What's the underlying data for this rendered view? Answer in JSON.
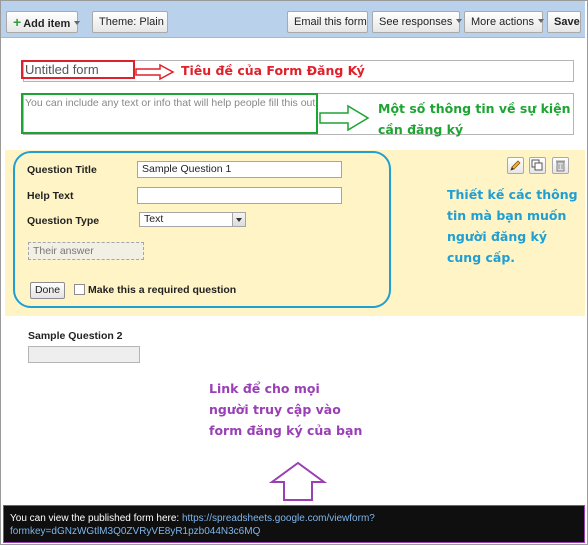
{
  "toolbar": {
    "add_item": "Add item",
    "theme_label": "Theme:",
    "theme_value": "Plain",
    "email_form": "Email this form",
    "see_responses": "See responses",
    "more_actions": "More actions",
    "save": "Save"
  },
  "form": {
    "title": "Untitled form",
    "description_placeholder": "You can include any text or info that will help people fill this out."
  },
  "question_editor": {
    "title_label": "Question Title",
    "title_value": "Sample Question 1",
    "help_label": "Help Text",
    "help_value": "",
    "type_label": "Question Type",
    "type_value": "Text",
    "answer_placeholder": "Their answer",
    "done": "Done",
    "required_label": "Make this a required question"
  },
  "question2": {
    "label": "Sample Question 2"
  },
  "annotations": {
    "title_note": "Tiêu đề của  Form Đăng Ký",
    "desc_note_line1": "Một số thông tin về sự kiện",
    "desc_note_line2": "cần đăng ký",
    "design_note_line1": "Thiết kế các thông",
    "design_note_line2": "tin mà bạn muốn",
    "design_note_line3": "người đăng ký",
    "design_note_line4": "cung cấp.",
    "link_note_line1": "Link để cho mọi",
    "link_note_line2": "người truy cập vào",
    "link_note_line3": "form đăng ký của bạn"
  },
  "footer": {
    "text": "You can view the published form here: ",
    "link_line1": "https://spreadsheets.google.com/viewform?",
    "link_line2": "formkey=dGNzWGtlM3Q0ZVRyVE8yR1pzb044N3c6MQ"
  },
  "colors": {
    "red": "#e0202a",
    "green": "#1ea432",
    "blue": "#1f9fd3",
    "purple": "#9a3fb5",
    "toolbar": "#b9d1ea",
    "panel": "#fff4c6"
  }
}
